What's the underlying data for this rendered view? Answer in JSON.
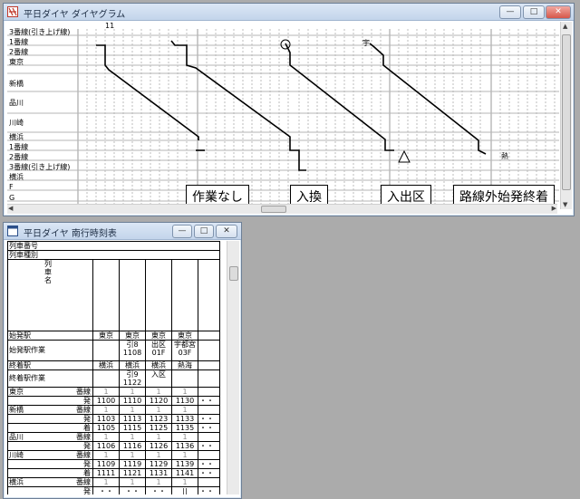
{
  "diagram_window": {
    "title": "平日ダイヤ ダイヤグラム",
    "hour_label": "11",
    "stations": [
      {
        "label": "3番線(引き上げ線)"
      },
      {
        "label": "1番線"
      },
      {
        "label": "2番線"
      },
      {
        "label": "東京"
      },
      {
        "label": "新橋"
      },
      {
        "label": "品川"
      },
      {
        "label": "川崎"
      },
      {
        "label": "横浜"
      },
      {
        "label": "1番線"
      },
      {
        "label": "2番線"
      },
      {
        "label": "3番線(引き上げ線)"
      },
      {
        "label": "横浜"
      },
      {
        "label": "F"
      },
      {
        "label": "G"
      }
    ],
    "marks": {
      "circle": "○",
      "uki": "宇",
      "atami": "熱",
      "triangle": "△"
    },
    "annotations": [
      "作業なし",
      "入換",
      "入出区",
      "路線外始発終着"
    ]
  },
  "timetable_window": {
    "title": "平日ダイヤ 南行時刻表",
    "header_rows": {
      "train_number": "列車番号",
      "train_type": "列車種別",
      "train_name": "列\n車\n名",
      "origin": "始発駅",
      "origin_work": "始発駅作業",
      "terminus": "終着駅",
      "terminus_work": "終着駅作業"
    },
    "origin_values": [
      "東京",
      "東京",
      "東京",
      "東京",
      ""
    ],
    "origin_work_values": [
      "",
      "引8\n1108",
      "出区\n01F",
      "宇都宮\n03F",
      ""
    ],
    "terminus_values": [
      "横浜",
      "横浜",
      "横浜",
      "熱海",
      ""
    ],
    "terminus_work_values": [
      "",
      "引9\n1122",
      "入区",
      "",
      ""
    ],
    "rows": [
      {
        "station": "東京",
        "kind": "番線",
        "cells": [
          "1",
          "1",
          "1",
          "1",
          ""
        ]
      },
      {
        "station": "",
        "kind": "発",
        "cells": [
          "1100",
          "1110",
          "1120",
          "1130",
          "・・"
        ]
      },
      {
        "station": "新橋",
        "kind": "番線",
        "cells": [
          "1",
          "1",
          "1",
          "1",
          ""
        ]
      },
      {
        "station": "",
        "kind": "発",
        "cells": [
          "1103",
          "1113",
          "1123",
          "1133",
          "・・"
        ]
      },
      {
        "station": "",
        "kind": "着",
        "cells": [
          "1105",
          "1115",
          "1125",
          "1135",
          "・・"
        ]
      },
      {
        "station": "品川",
        "kind": "番線",
        "cells": [
          "1",
          "1",
          "1",
          "1",
          ""
        ]
      },
      {
        "station": "",
        "kind": "発",
        "cells": [
          "1106",
          "1116",
          "1126",
          "1136",
          "・・"
        ]
      },
      {
        "station": "川崎",
        "kind": "番線",
        "cells": [
          "1",
          "1",
          "1",
          "1",
          ""
        ]
      },
      {
        "station": "",
        "kind": "発",
        "cells": [
          "1109",
          "1119",
          "1129",
          "1139",
          "・・"
        ]
      },
      {
        "station": "",
        "kind": "着",
        "cells": [
          "1111",
          "1121",
          "1131",
          "1141",
          "・・"
        ]
      },
      {
        "station": "横浜",
        "kind": "番線",
        "cells": [
          "1",
          "1",
          "1",
          "1",
          ""
        ]
      },
      {
        "station": "",
        "kind": "発",
        "cells": [
          "・・",
          "・・",
          "・・",
          "||",
          "・・"
        ]
      }
    ]
  },
  "window_buttons": {
    "minimize": "—",
    "maximize": "□",
    "close": "✕"
  }
}
